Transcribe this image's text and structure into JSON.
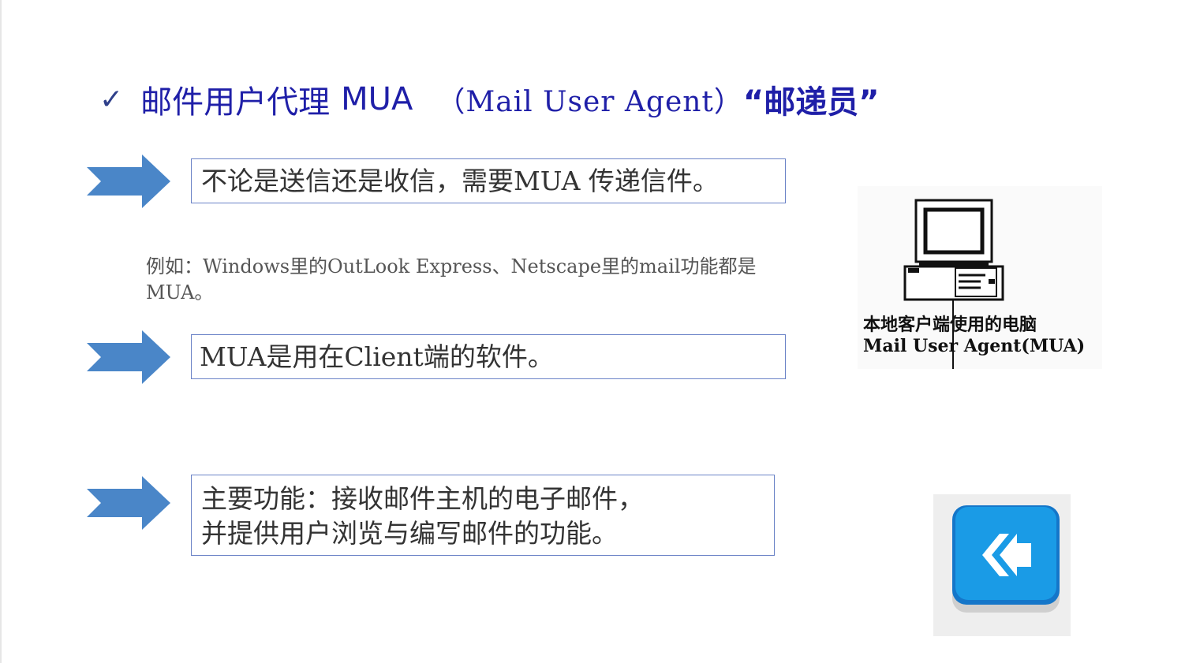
{
  "title": {
    "check_icon": "check-icon",
    "cn": "邮件用户代理",
    "en": "MUA",
    "paren": "（Mail User Agent）",
    "quote": "“邮递员”"
  },
  "points": [
    {
      "text": "不论是送信还是收信，需要MUA 传递信件。"
    },
    {
      "text": "MUA是用在Client端的软件。"
    },
    {
      "line1": "主要功能：接收邮件主机的电子邮件，",
      "line2": "并提供用户浏览与编写邮件的功能。"
    }
  ],
  "example": "例如：Windows里的OutLook Express、Netscape里的mail功能都是MUA。",
  "figure": {
    "caption_line1": "本地客户端使用的电脑",
    "caption_line2": "Mail User Agent(MUA)"
  },
  "back_button": {
    "icon": "back-arrow-icon"
  },
  "colors": {
    "title": "#1f1fa8",
    "arrow": "#4a86c8",
    "box_border": "#6b83c7",
    "back_button": "#1a9be6"
  }
}
